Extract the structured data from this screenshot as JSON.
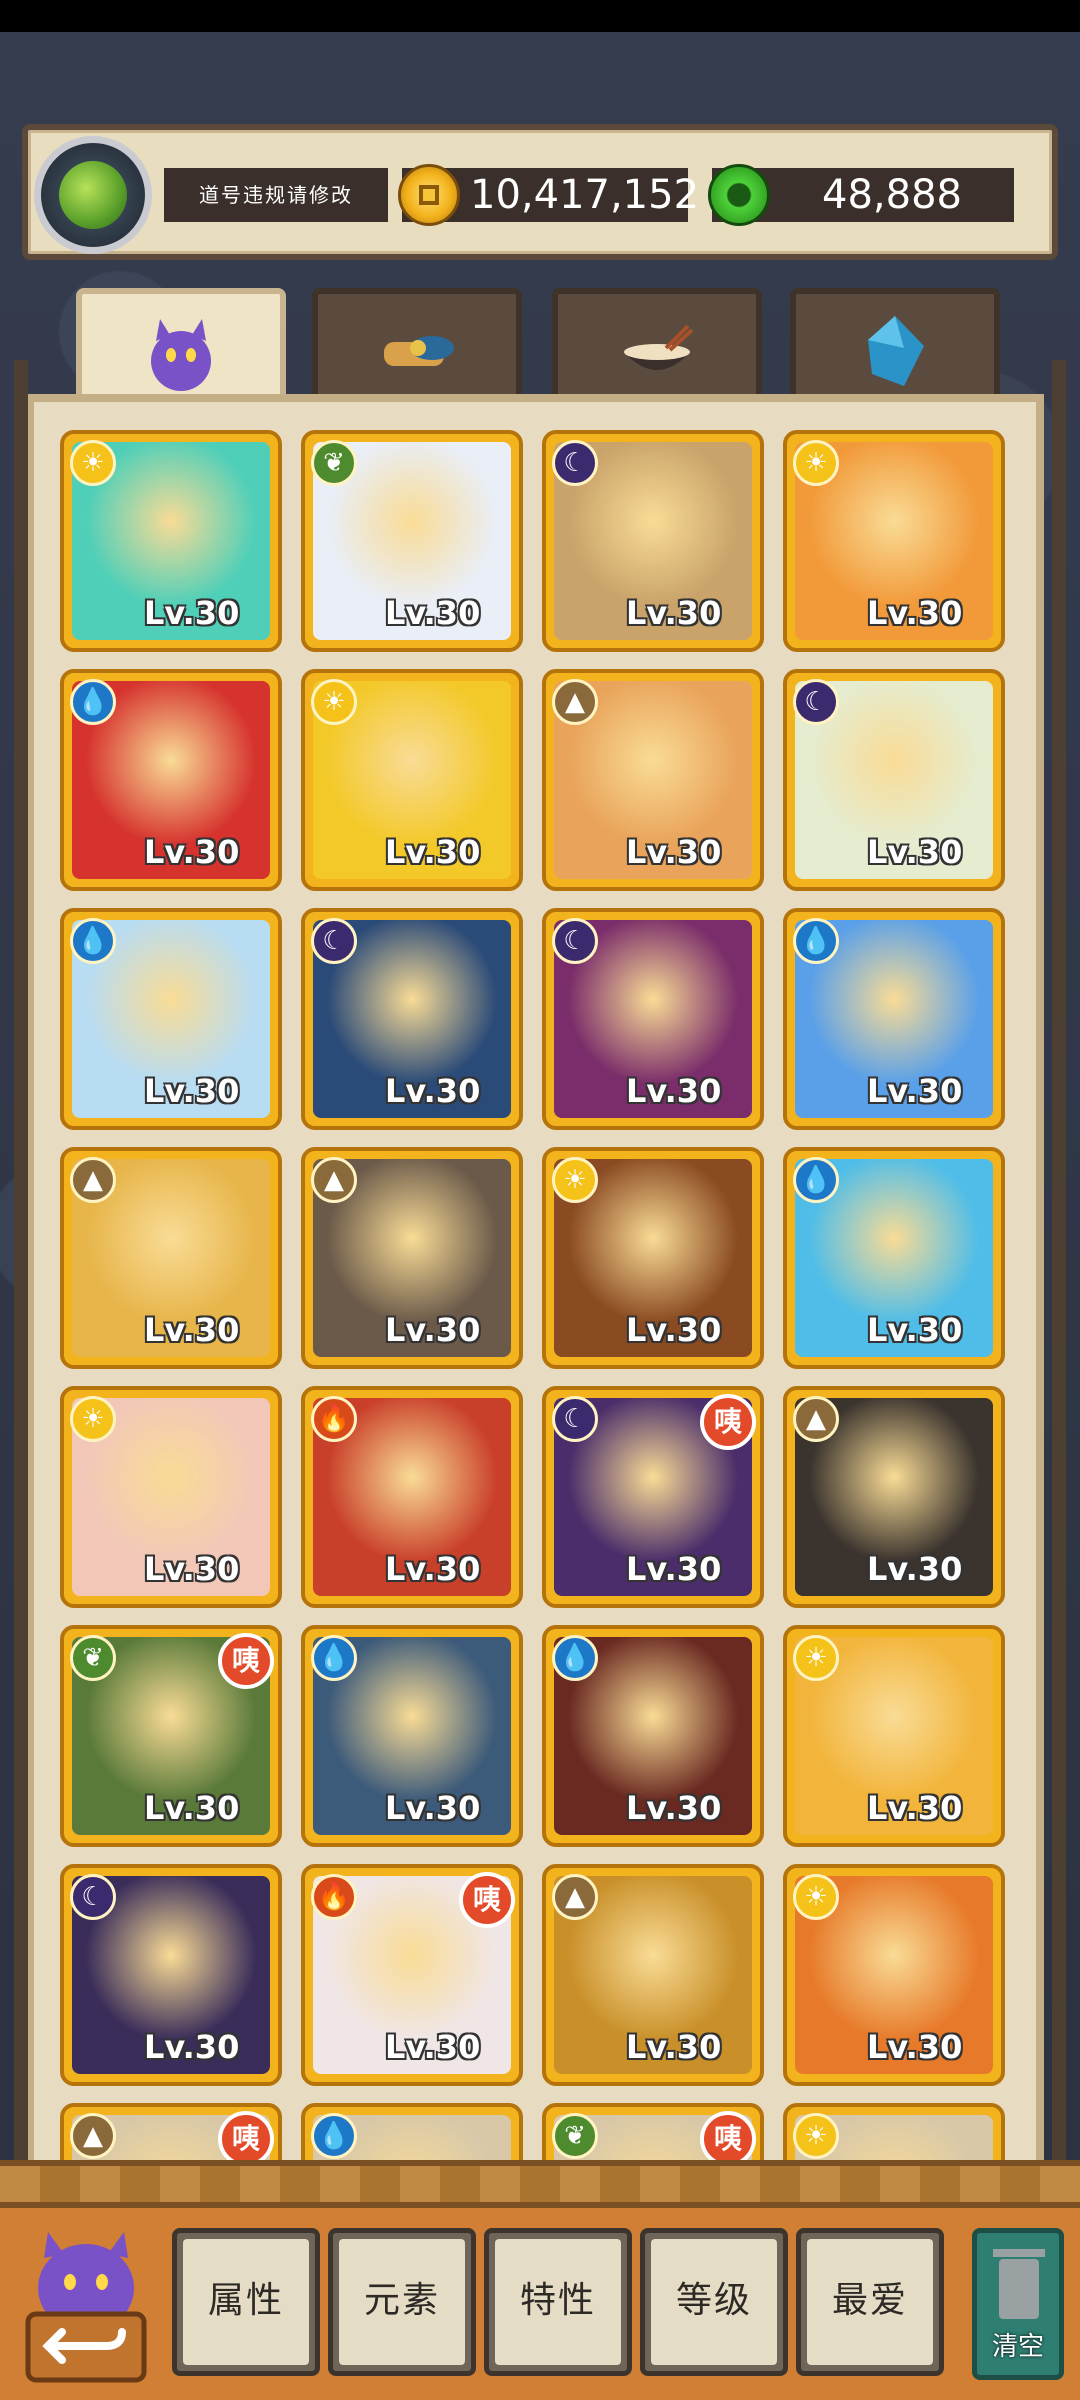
{
  "player": {
    "name_notice": "道号违规请修改"
  },
  "currency": {
    "coins": "10,417,152",
    "jade": "48,888"
  },
  "tabs": [
    {
      "name": "heroes",
      "icon": "purple-monster-icon",
      "active": true
    },
    {
      "name": "items",
      "icon": "scroll-feather-icon",
      "active": false
    },
    {
      "name": "food",
      "icon": "noodle-bowl-icon",
      "active": false
    },
    {
      "name": "gems",
      "icon": "blue-crystal-icon",
      "active": false
    }
  ],
  "heroes": [
    {
      "element": "sun",
      "level": "Lv.30",
      "art": "#4fcfb8"
    },
    {
      "element": "leaf",
      "level": "Lv.30",
      "art": "#e9eef7"
    },
    {
      "element": "moon",
      "level": "Lv.30",
      "art": "#c9a36a"
    },
    {
      "element": "sun",
      "level": "Lv.30",
      "art": "#f29a3a"
    },
    {
      "element": "water",
      "level": "Lv.30",
      "art": "#d6332e"
    },
    {
      "element": "sun",
      "level": "Lv.30",
      "art": "#f3c92a"
    },
    {
      "element": "earth",
      "level": "Lv.30",
      "art": "#e9a35a"
    },
    {
      "element": "moon",
      "level": "Lv.30",
      "art": "#e5ecd0"
    },
    {
      "element": "water",
      "level": "Lv.30",
      "art": "#b8dcf2"
    },
    {
      "element": "moon",
      "level": "Lv.30",
      "art": "#2a4a78"
    },
    {
      "element": "moon",
      "level": "Lv.30",
      "art": "#7a2d6a"
    },
    {
      "element": "water",
      "level": "Lv.30",
      "art": "#5aa0e8"
    },
    {
      "element": "earth",
      "level": "Lv.30",
      "art": "#e7b54a"
    },
    {
      "element": "earth",
      "level": "Lv.30",
      "art": "#6b5a4a"
    },
    {
      "element": "sun",
      "level": "Lv.30",
      "art": "#8a4a22"
    },
    {
      "element": "water",
      "level": "Lv.30",
      "art": "#4fbde8"
    },
    {
      "element": "sun",
      "level": "Lv.30",
      "art": "#f2c7b8"
    },
    {
      "element": "fire",
      "level": "Lv.30",
      "art": "#c9402a"
    },
    {
      "element": "moon",
      "level": "Lv.30",
      "art": "#4a2d6a",
      "badge": "咦"
    },
    {
      "element": "earth",
      "level": "Lv.30",
      "art": "#3a332e"
    },
    {
      "element": "leaf",
      "level": "Lv.30",
      "art": "#5a7a3a",
      "badge": "咦"
    },
    {
      "element": "water",
      "level": "Lv.30",
      "art": "#3c5a7a"
    },
    {
      "element": "water",
      "level": "Lv.30",
      "art": "#6a2a22"
    },
    {
      "element": "sun",
      "level": "Lv.30",
      "art": "#f2b43a"
    },
    {
      "element": "moon",
      "level": "Lv.30",
      "art": "#3a2d5a"
    },
    {
      "element": "fire",
      "level": "Lv.30",
      "art": "#f0e6e6",
      "badge": "咦"
    },
    {
      "element": "earth",
      "level": "Lv.30",
      "art": "#c9902a"
    },
    {
      "element": "sun",
      "level": "Lv.30",
      "art": "#e77a2a"
    },
    {
      "element": "earth",
      "level": "",
      "art": "#d8c8a8",
      "badge": "咦"
    },
    {
      "element": "water",
      "level": "",
      "art": "#d8c8a8"
    },
    {
      "element": "leaf",
      "level": "",
      "art": "#d8c8a8",
      "badge": "咦"
    },
    {
      "element": "sun",
      "level": "",
      "art": "#d8c8a8"
    }
  ],
  "filters": {
    "attribute": "属性",
    "element": "元素",
    "trait": "特性",
    "level": "等级",
    "favorite": "最爱"
  },
  "clear_label": "清空",
  "element_colors": {
    "sun": "#f5c21a",
    "leaf": "#4e8a2e",
    "moon": "#3b2a6e",
    "water": "#1e78c8",
    "earth": "#8a6a3a",
    "fire": "#d84a1a"
  }
}
